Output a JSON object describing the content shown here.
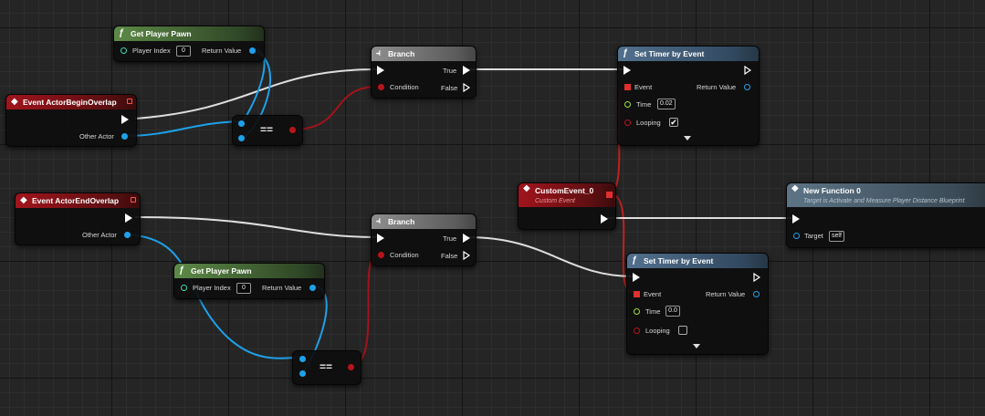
{
  "nodes": {
    "get_pawn_1": {
      "title": "Get Player Pawn",
      "player_index_label": "Player Index",
      "player_index_value": "0",
      "return_label": "Return Value"
    },
    "begin_overlap": {
      "title": "Event ActorBeginOverlap",
      "other_actor_label": "Other Actor"
    },
    "equal_1": {
      "op": "=="
    },
    "branch_1": {
      "title": "Branch",
      "condition_label": "Condition",
      "true_label": "True",
      "false_label": "False"
    },
    "timer_1": {
      "title": "Set Timer by Event",
      "event_label": "Event",
      "return_label": "Return Value",
      "time_label": "Time",
      "time_value": "0.02",
      "looping_label": "Looping",
      "looping_checked": "✔"
    },
    "custom_event": {
      "title": "CustomEvent_0",
      "subtitle": "Custom Event"
    },
    "new_function": {
      "title": "New Function 0",
      "subtitle": "Target is Activate and Measure Player Distance Blueprint",
      "target_label": "Target",
      "target_value": "self"
    },
    "end_overlap": {
      "title": "Event ActorEndOverlap",
      "other_actor_label": "Other Actor"
    },
    "branch_2": {
      "title": "Branch",
      "condition_label": "Condition",
      "true_label": "True",
      "false_label": "False"
    },
    "get_pawn_2": {
      "title": "Get Player Pawn",
      "player_index_label": "Player Index",
      "player_index_value": "0",
      "return_label": "Return Value"
    },
    "timer_2": {
      "title": "Set Timer by Event",
      "event_label": "Event",
      "return_label": "Return Value",
      "time_label": "Time",
      "time_value": "0.0",
      "looping_label": "Looping",
      "looping_checked": ""
    },
    "equal_2": {
      "op": "=="
    }
  },
  "icons": {
    "function": "function-f-icon",
    "event": "event-diamond-icon",
    "branch": "branch-icon"
  },
  "colors": {
    "exec_wire": "#e8e8e8",
    "object_wire": "#1ea1ea",
    "bool_wire": "#b8141c",
    "delegate_wire": "#e03030"
  }
}
